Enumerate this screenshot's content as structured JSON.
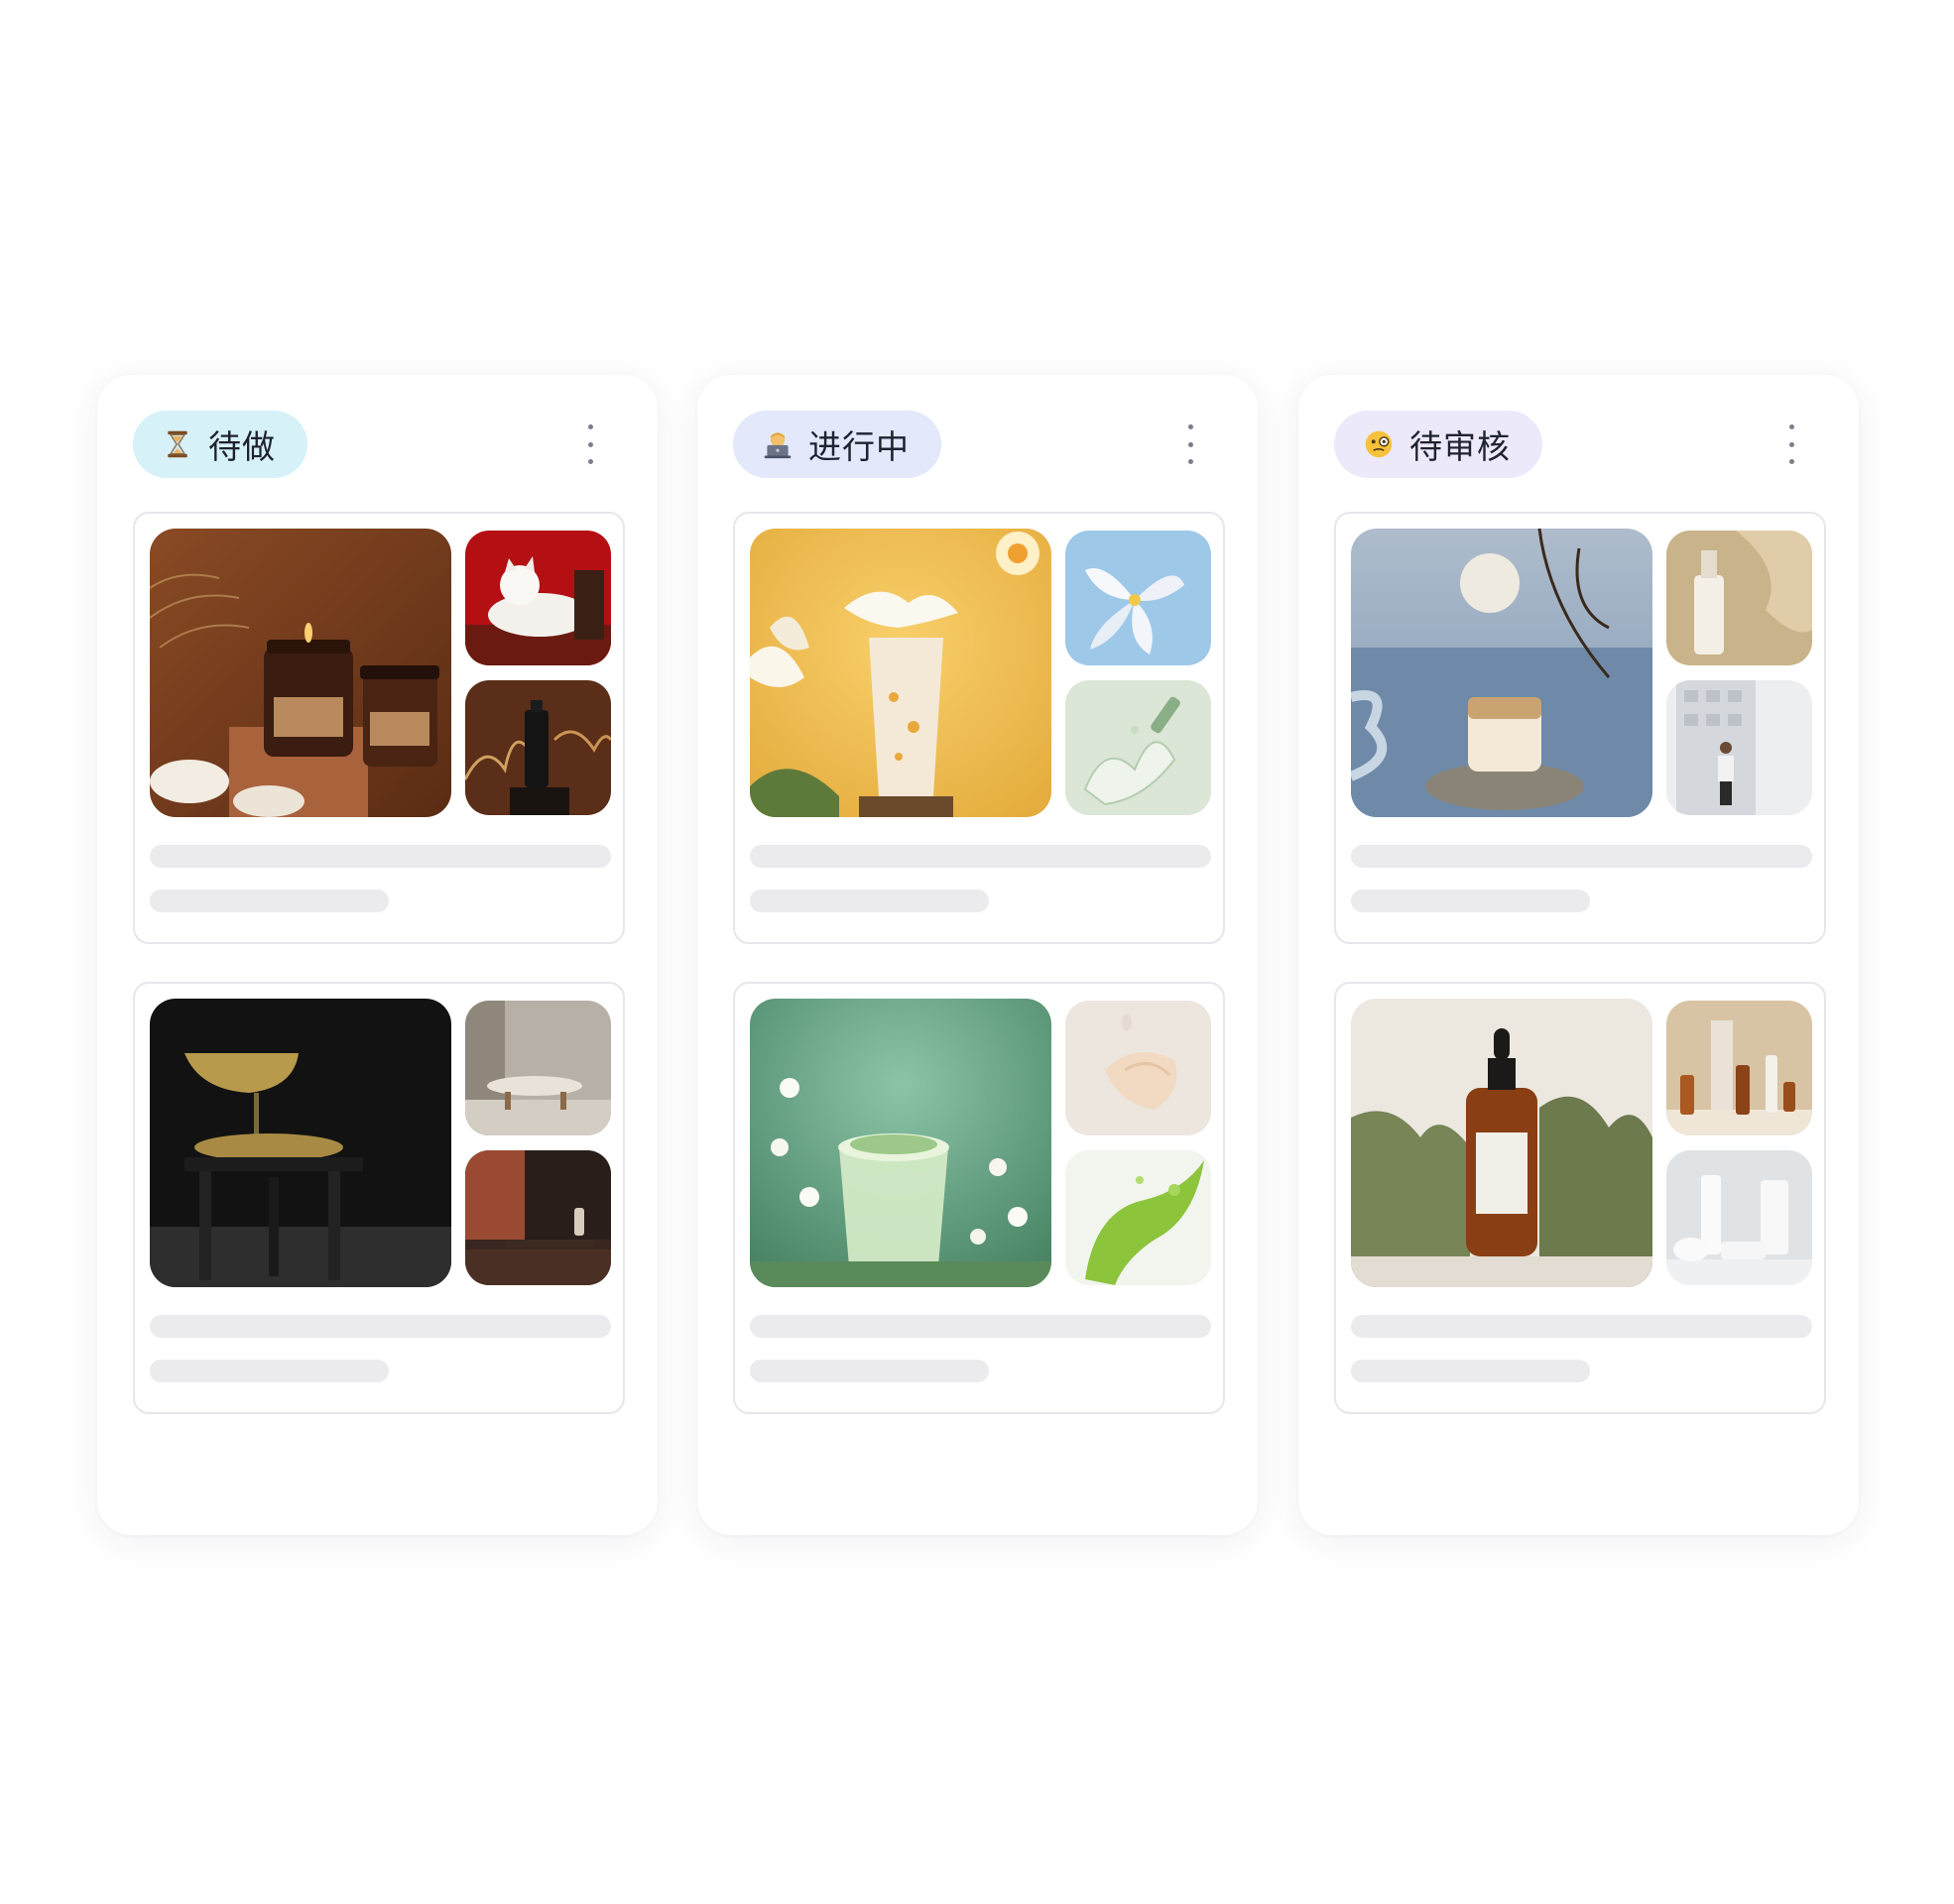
{
  "columns": [
    {
      "label": "待做",
      "icon": "hourglass-icon",
      "accent": "#d6f1f8"
    },
    {
      "label": "进行中",
      "icon": "person-laptop-icon",
      "accent": "#e3e8fb"
    },
    {
      "label": "待审核",
      "icon": "monocle-face-icon",
      "accent": "#ece9fb"
    }
  ]
}
